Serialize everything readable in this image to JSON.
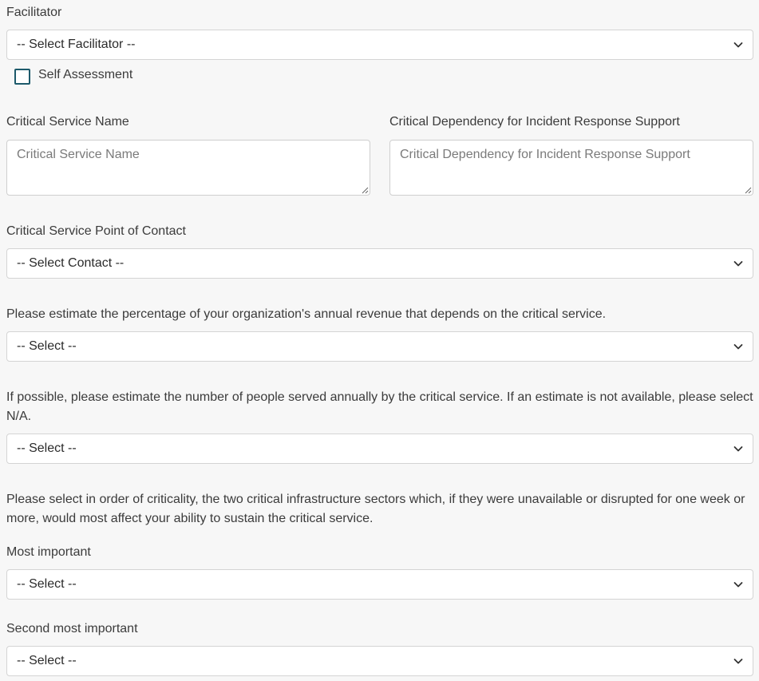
{
  "facilitator": {
    "label": "Facilitator",
    "select_value": "-- Select Facilitator --",
    "self_assessment_label": "Self Assessment",
    "self_assessment_checked": false
  },
  "critical_service_name": {
    "label": "Critical Service Name",
    "placeholder": "Critical Service Name"
  },
  "critical_dependency": {
    "label": "Critical Dependency for Incident Response Support",
    "placeholder": "Critical Dependency for Incident Response Support"
  },
  "point_of_contact": {
    "label": "Critical Service Point of Contact",
    "select_value": "-- Select Contact --"
  },
  "revenue": {
    "label": "Please estimate the percentage of your organization's annual revenue that depends on the critical service.",
    "select_value": "-- Select --"
  },
  "people_served": {
    "label": "If possible, please estimate the number of people served annually by the critical service. If an estimate is not available, please select N/A.",
    "select_value": "-- Select --"
  },
  "sectors": {
    "question": "Please select in order of criticality, the two critical infrastructure sectors which, if they were unavailable or disrupted for one week or more, would most affect your ability to sustain the critical service.",
    "most_important_label": "Most important",
    "most_important_value": "-- Select --",
    "second_label": "Second most important",
    "second_value": "-- Select --"
  },
  "icons": {
    "select_arrow": "chevron-down-icon",
    "resize": "resize-grip-icon"
  },
  "colors": {
    "checkbox_border": "#1d5a6b",
    "background": "#f7f7f7"
  }
}
